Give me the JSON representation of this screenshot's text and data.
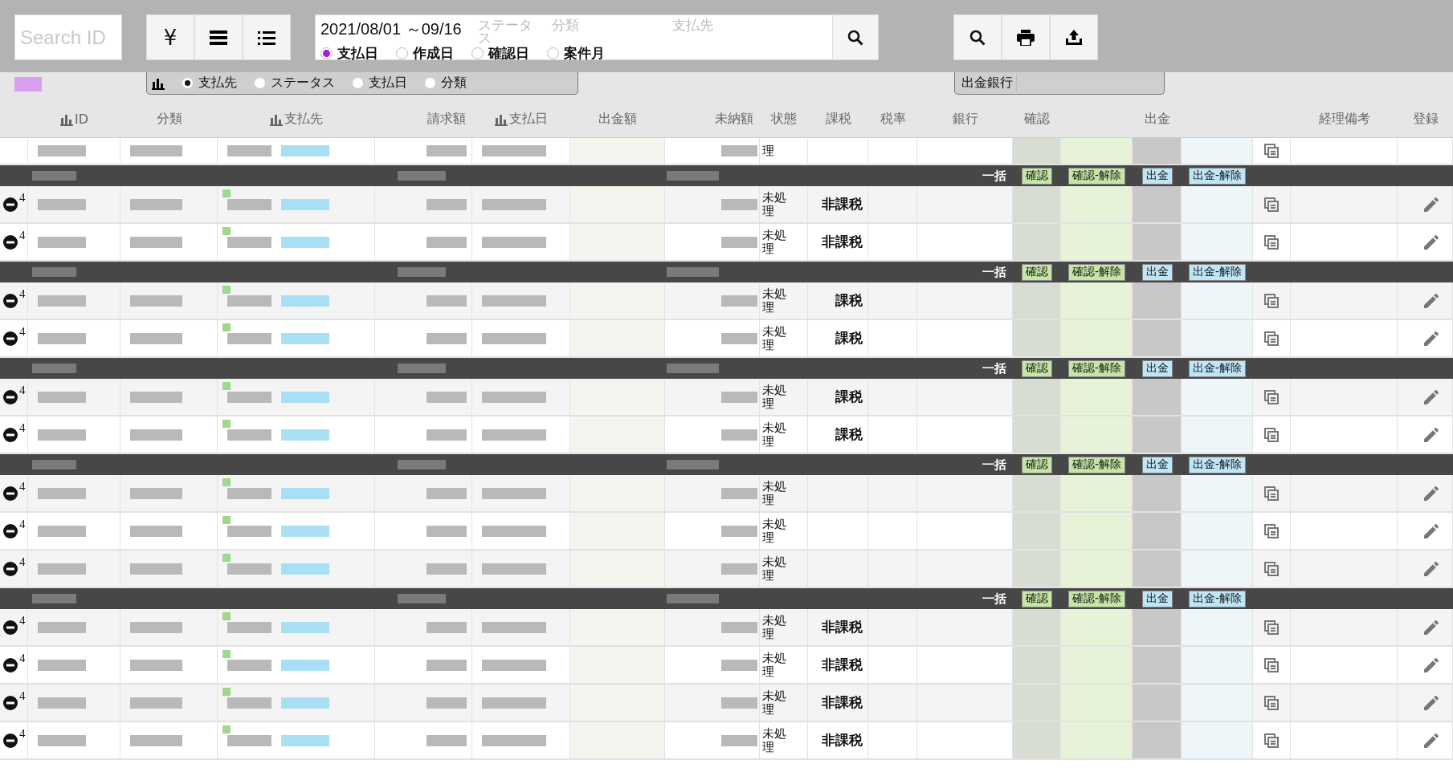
{
  "search": {
    "placeholder": "Search ID"
  },
  "view_buttons": [
    {
      "kind": "yen",
      "label": "¥"
    },
    {
      "kind": "bars"
    },
    {
      "kind": "list"
    }
  ],
  "filter": {
    "date_range": "2021/08/01 ～09/16",
    "fields": [
      {
        "placeholder": "ステータス"
      },
      {
        "placeholder": "分類"
      },
      {
        "placeholder": "支払先"
      }
    ],
    "date_types": [
      {
        "label": "支払日",
        "selected": true
      },
      {
        "label": "作成日",
        "selected": false
      },
      {
        "label": "確認日",
        "selected": false
      },
      {
        "label": "案件月",
        "selected": false
      }
    ]
  },
  "group_by": [
    {
      "label": "支払先",
      "selected": true
    },
    {
      "label": "ステータス",
      "selected": false
    },
    {
      "label": "支払日",
      "selected": false
    },
    {
      "label": "分類",
      "selected": false
    }
  ],
  "bank_filter": {
    "label": "出金銀行"
  },
  "table": {
    "columns": [
      {
        "label": "ID",
        "kind": "chart"
      },
      {
        "label": "分類",
        "kind": "plain"
      },
      {
        "label": "支払先",
        "kind": "chart"
      },
      {
        "label": "請求額",
        "kind": "amount"
      },
      {
        "label": "支払日",
        "kind": "chart"
      },
      {
        "label": "出金額",
        "kind": "plain"
      },
      {
        "label": "未納額",
        "kind": "amount"
      },
      {
        "label": "状態",
        "kind": "plain"
      },
      {
        "label": "課税",
        "kind": "plain"
      },
      {
        "label": "税率",
        "kind": "plain"
      },
      {
        "label": "銀行",
        "kind": "plain"
      },
      {
        "label": "確認",
        "kind": "plain"
      },
      {
        "label": "出金",
        "kind": "plain"
      },
      {
        "label": "経理備考",
        "kind": "plain"
      },
      {
        "label": "登録",
        "kind": "plain"
      }
    ],
    "partial_row": {
      "status": "理"
    },
    "groups": [
      {
        "bulk_label": "一括",
        "buttons": [
          {
            "kind": "confirm",
            "label": "確認"
          },
          {
            "kind": "confirm",
            "label": "確認-解除"
          },
          {
            "kind": "payout",
            "label": "出金"
          },
          {
            "kind": "payout",
            "label": "出金-解除"
          }
        ],
        "rows": [
          {
            "id": "4",
            "status": "未処理",
            "tax": "非課税"
          },
          {
            "id": "4",
            "status": "未処理",
            "tax": "非課税"
          }
        ]
      },
      {
        "bulk_label": "一括",
        "buttons": [
          {
            "kind": "confirm",
            "label": "確認"
          },
          {
            "kind": "confirm",
            "label": "確認-解除"
          },
          {
            "kind": "payout",
            "label": "出金"
          },
          {
            "kind": "payout",
            "label": "出金-解除"
          }
        ],
        "rows": [
          {
            "id": "4",
            "status": "未処理",
            "tax": "課税"
          },
          {
            "id": "4",
            "status": "未処理",
            "tax": "課税"
          }
        ]
      },
      {
        "bulk_label": "一括",
        "buttons": [
          {
            "kind": "confirm",
            "label": "確認"
          },
          {
            "kind": "confirm",
            "label": "確認-解除"
          },
          {
            "kind": "payout",
            "label": "出金"
          },
          {
            "kind": "payout",
            "label": "出金-解除"
          }
        ],
        "rows": [
          {
            "id": "4",
            "status": "未処理",
            "tax": "課税"
          },
          {
            "id": "4",
            "status": "未処理",
            "tax": "課税"
          }
        ]
      },
      {
        "bulk_label": "一括",
        "buttons": [
          {
            "kind": "confirm",
            "label": "確認"
          },
          {
            "kind": "confirm",
            "label": "確認-解除"
          },
          {
            "kind": "payout",
            "label": "出金"
          },
          {
            "kind": "payout",
            "label": "出金-解除"
          }
        ],
        "rows": [
          {
            "id": "4",
            "status": "未処理"
          },
          {
            "id": "4",
            "status": "未処理"
          },
          {
            "id": "4",
            "status": "未処理"
          }
        ]
      },
      {
        "bulk_label": "一括",
        "buttons": [
          {
            "kind": "confirm",
            "label": "確認"
          },
          {
            "kind": "confirm",
            "label": "確認-解除"
          },
          {
            "kind": "payout",
            "label": "出金"
          },
          {
            "kind": "payout",
            "label": "出金-解除"
          }
        ],
        "rows": [
          {
            "id": "4",
            "status": "未処理",
            "tax": "非課税"
          },
          {
            "id": "4",
            "status": "未処理",
            "tax": "非課税"
          },
          {
            "id": "4",
            "status": "未処理",
            "tax": "非課税"
          },
          {
            "id": "4",
            "status": "未処理",
            "tax": "非課税"
          }
        ]
      }
    ]
  }
}
